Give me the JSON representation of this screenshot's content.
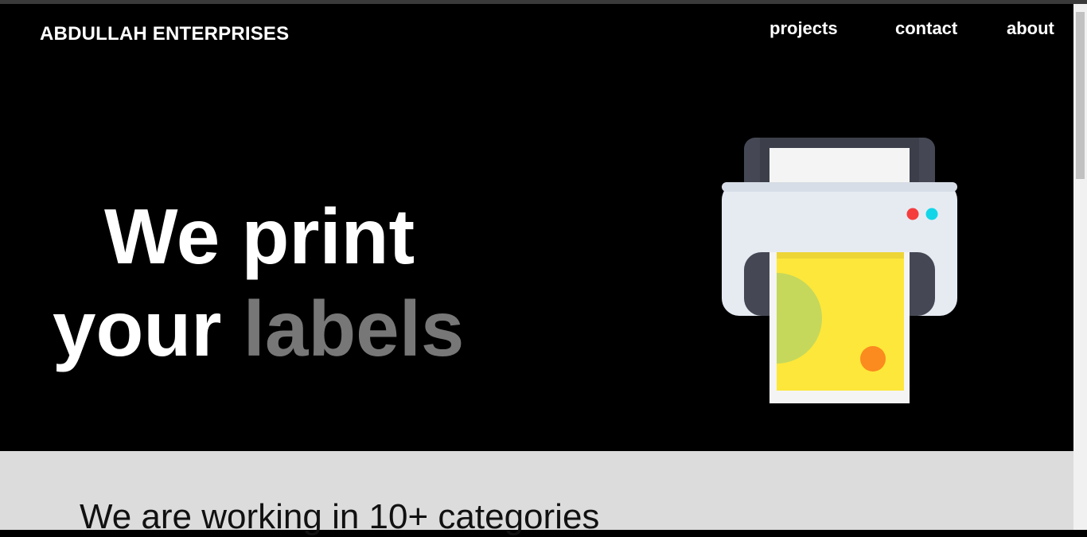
{
  "header": {
    "brand": "ABDULLAH ENTERPRISES",
    "nav": [
      {
        "label": "projects"
      },
      {
        "label": "contact"
      },
      {
        "label": "about"
      }
    ]
  },
  "hero": {
    "line1": "We print",
    "line2_plain": "your ",
    "line2_accent": "labels",
    "illustration": "printer-icon"
  },
  "section": {
    "heading": "We are working in 10+ categories"
  },
  "colors": {
    "background": "#000000",
    "accent_text": "#777777",
    "section_bg": "#dcdcdc",
    "paper_yellow": "#fde73a"
  }
}
